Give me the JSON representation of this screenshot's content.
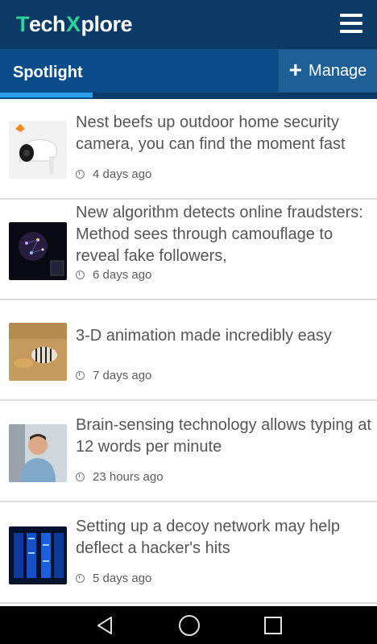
{
  "header": {
    "logo_prefix": "T",
    "logo_mid": "ech",
    "logo_x": "X",
    "logo_suffix": "plore"
  },
  "tabs": {
    "active": "Spotlight",
    "manage_icon": "+",
    "manage_label": "Manage"
  },
  "colors": {
    "header_bg": "#0b3a66",
    "tab_bg": "#0a4d8a",
    "accent": "#2aa0ea",
    "logo_green": "#2fd39a"
  },
  "articles": [
    {
      "headline": "Nest beefs up outdoor home security camera, you can find the moment fast",
      "time": "4 days ago",
      "thumb": "security-camera-image"
    },
    {
      "headline": "New algorithm detects online fraudsters: Method sees through camouflage to reveal fake followers,",
      "time": "6 days ago",
      "thumb": "network-graph-image"
    },
    {
      "headline": "3-D animation made incredibly easy",
      "time": "7 days ago",
      "thumb": "zebras-cheetah-image"
    },
    {
      "headline": "Brain-sensing technology allows typing at 12 words per minute",
      "time": "23 hours ago",
      "thumb": "researcher-portrait-image"
    },
    {
      "headline": "Setting up a decoy network may help deflect a hacker's hits",
      "time": "5 days ago",
      "thumb": "server-room-image"
    }
  ],
  "nav": {
    "back_icon": "triangle-back",
    "home_icon": "circle-home",
    "recent_icon": "square-recents"
  }
}
